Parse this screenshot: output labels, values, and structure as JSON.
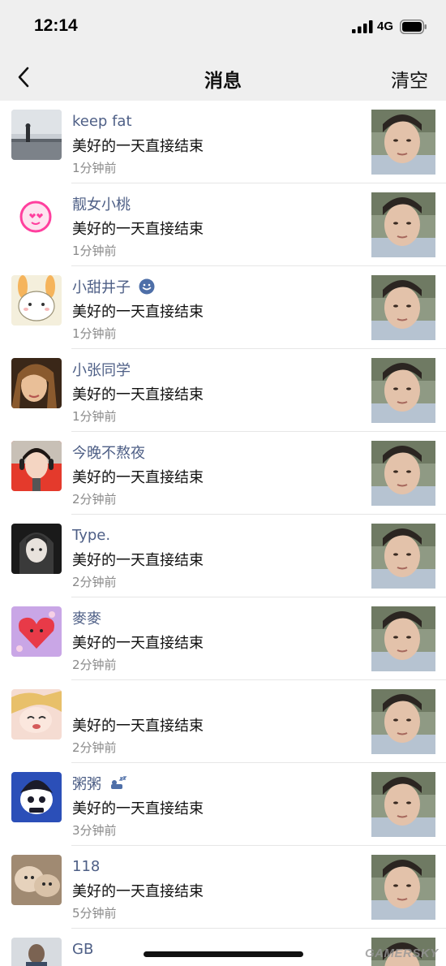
{
  "status_bar": {
    "time": "12:14",
    "network": "4G"
  },
  "nav": {
    "title": "消息",
    "clear_label": "清空",
    "back_icon": "chevron-left-icon"
  },
  "messages": [
    {
      "name": "keep fat",
      "text": "美好的一天直接结束",
      "time": "1分钟前",
      "badge": ""
    },
    {
      "name": "靓女小桃",
      "text": "美好的一天直接结束",
      "time": "1分钟前",
      "badge": ""
    },
    {
      "name": "小甜井子",
      "text": "美好的一天直接结束",
      "time": "1分钟前",
      "badge": "smiley-badge-icon"
    },
    {
      "name": "小张同学",
      "text": "美好的一天直接结束",
      "time": "1分钟前",
      "badge": ""
    },
    {
      "name": "今晚不熬夜",
      "text": "美好的一天直接结束",
      "time": "2分钟前",
      "badge": ""
    },
    {
      "name": "Type.",
      "text": "美好的一天直接结束",
      "time": "2分钟前",
      "badge": ""
    },
    {
      "name": "麥麥",
      "text": "美好的一天直接结束",
      "time": "2分钟前",
      "badge": ""
    },
    {
      "name": "",
      "text": "美好的一天直接结束",
      "time": "2分钟前",
      "badge": ""
    },
    {
      "name": "粥粥",
      "text": "美好的一天直接结束",
      "time": "3分钟前",
      "badge": "sleep-badge-icon"
    },
    {
      "name": "118",
      "text": "美好的一天直接结束",
      "time": "5分钟前",
      "badge": ""
    },
    {
      "name": "GB",
      "text": "",
      "time": "",
      "badge": ""
    }
  ],
  "watermark": "GAMERSKY",
  "colors": {
    "username": "#4e5f86",
    "header_bg": "#efefef",
    "time": "#8a8a8a",
    "badge_blue": "#4e6fa8"
  }
}
